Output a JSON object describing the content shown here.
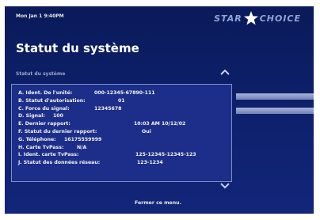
{
  "header": {
    "datetime": "Mon Jan 1 9:40PM",
    "logo_left": "STAR",
    "logo_right": "CHOICE"
  },
  "page_title": "Statut du système",
  "section_label": "Statut du système",
  "status_items": [
    {
      "label": "A. Ident. De l'unité:",
      "value": "000-12345-67890-111"
    },
    {
      "label": "B. Statut d'autorisation:",
      "value": "01"
    },
    {
      "label": "C. Force du signal:",
      "value": "12345678"
    },
    {
      "label": "D. Signal:",
      "value": "100"
    },
    {
      "label": "E. Dernier rapport:",
      "value": "10:03 AM 10/12/02"
    },
    {
      "label": "F. Statut du dernier rapport:",
      "value": "Oui"
    },
    {
      "label": "G. Téléphone:",
      "value": "16175559999"
    },
    {
      "label": "H. Carte TvPass:",
      "value": "N/A"
    },
    {
      "label": "I. Ident. carte TvPass:",
      "value": "125-12345-12345-123"
    },
    {
      "label": "J. Statut des données réseau:",
      "value": "123-1234"
    }
  ],
  "footer": {
    "close_menu": "Fermer ce menu."
  },
  "colors": {
    "background": "#0d1f68",
    "panel": "#1c2e8a",
    "panel_border": "#7d8fc9",
    "text": "#f2f2f2",
    "accent_bar": "#a8b4d8"
  }
}
